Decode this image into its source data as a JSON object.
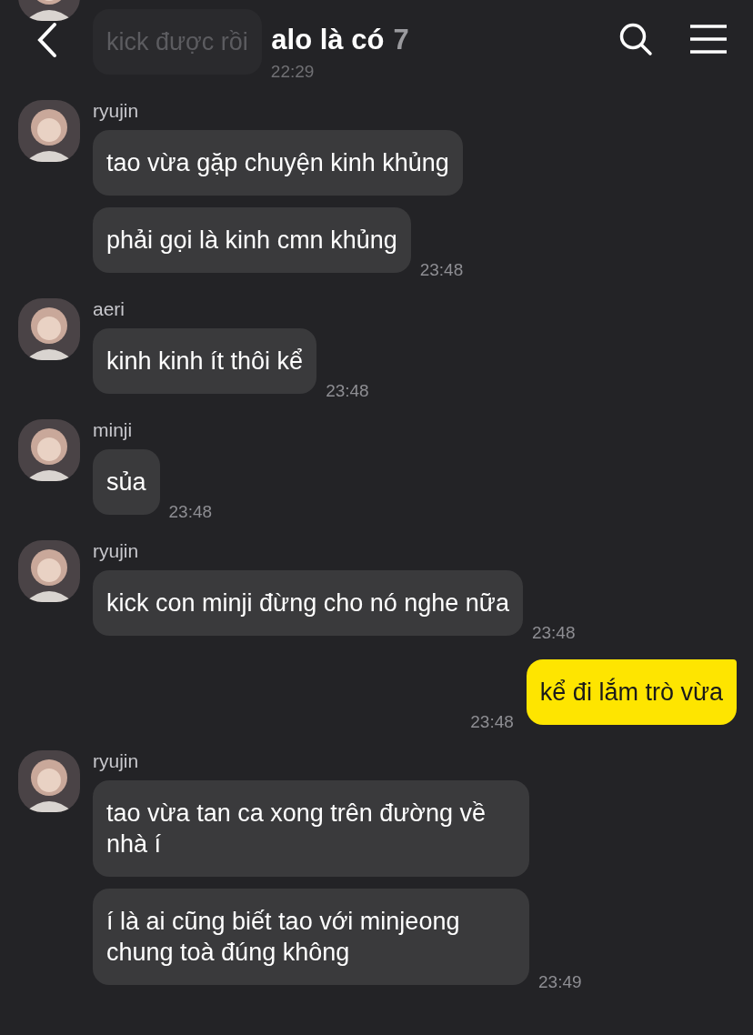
{
  "header": {
    "title": "alo là có",
    "member_count": "7"
  },
  "messages": [
    {
      "kind": "received",
      "bubbles": [
        "kick được rồi"
      ],
      "time": "22:29",
      "faded": true
    },
    {
      "kind": "received",
      "sender": "ryujin",
      "bubbles": [
        "tao vừa gặp chuyện kinh khủng",
        "phải gọi là kinh cmn khủng"
      ],
      "time": "23:48"
    },
    {
      "kind": "received",
      "sender": "aeri",
      "bubbles": [
        "kinh kinh ít thôi kể"
      ],
      "time": "23:48"
    },
    {
      "kind": "received",
      "sender": "minji",
      "bubbles": [
        "sủa"
      ],
      "time": "23:48"
    },
    {
      "kind": "received",
      "sender": "ryujin",
      "bubbles": [
        "kick con minji đừng cho nó nghe nữa"
      ],
      "time": "23:48"
    },
    {
      "kind": "sent",
      "bubbles": [
        "kể đi lắm trò vừa"
      ],
      "time": "23:48"
    },
    {
      "kind": "received",
      "sender": "ryujin",
      "bubbles": [
        "tao vừa tan ca xong trên đường về nhà í",
        "í là ai cũng biết tao với minjeong chung toà đúng không"
      ],
      "time": "23:49"
    }
  ]
}
